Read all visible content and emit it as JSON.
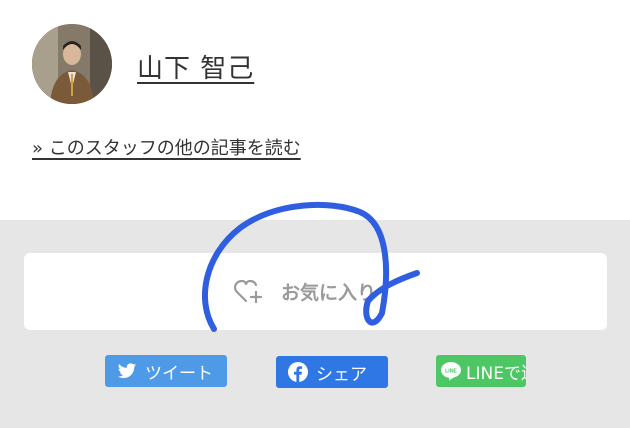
{
  "author": {
    "name": "山下 智己",
    "avatar_icon": "staff-photo"
  },
  "more_articles_link": "» このスタッフの他の記事を読む",
  "favorite": {
    "label": "お気に入り",
    "icon": "heart-plus-icon",
    "color": "#9a9a9a"
  },
  "share": {
    "twitter": {
      "label": "ツイート",
      "icon": "twitter-bird-icon",
      "color": "#4f9ae6"
    },
    "facebook": {
      "label": "シェア",
      "icon": "facebook-icon",
      "color": "#2f77e4"
    },
    "line": {
      "label": "LINEで送る",
      "icon": "line-icon",
      "icon_text": "LINE",
      "color": "#4cc764"
    }
  },
  "annotation": {
    "stroke_color": "#2f5fe0"
  }
}
